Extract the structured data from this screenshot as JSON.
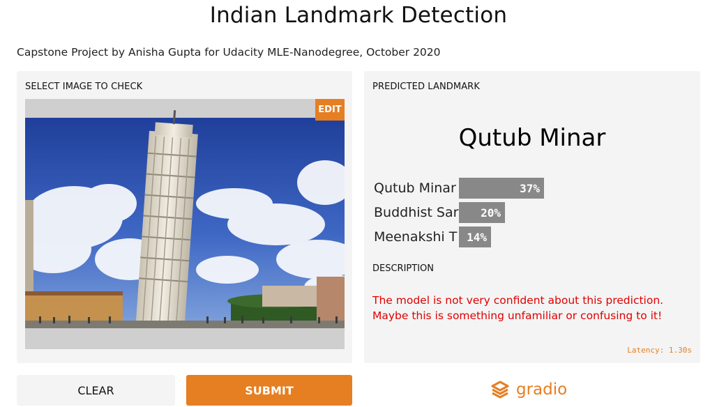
{
  "header": {
    "title": "Indian Landmark Detection",
    "subtitle": "Capstone Project by Anisha Gupta for Udacity MLE-Nanodegree, October 2020"
  },
  "input_panel": {
    "label": "SELECT IMAGE TO CHECK",
    "edit_label": "EDIT"
  },
  "output_panel": {
    "label": "PREDICTED LANDMARK",
    "prediction": "Qutub Minar",
    "confidences": [
      {
        "label": "Qutub Minar",
        "percent_text": "37%",
        "value": 0.37
      },
      {
        "label": "Buddhist Sar",
        "percent_text": "20%",
        "value": 0.2
      },
      {
        "label": "Meenakshi T",
        "percent_text": "14%",
        "value": 0.14
      }
    ],
    "description_label": "DESCRIPTION",
    "description": "The model is not very confident about this prediction. Maybe this is something unfamiliar or confusing to it!",
    "latency": "Latency: 1.30s"
  },
  "actions": {
    "clear_label": "CLEAR",
    "submit_label": "SUBMIT"
  },
  "brand": {
    "name": "gradio",
    "color": "#e67e22"
  },
  "colors": {
    "accent": "#e67e22",
    "panel_bg": "#f4f4f4",
    "bar": "#888888",
    "warning_text": "#e00000"
  }
}
